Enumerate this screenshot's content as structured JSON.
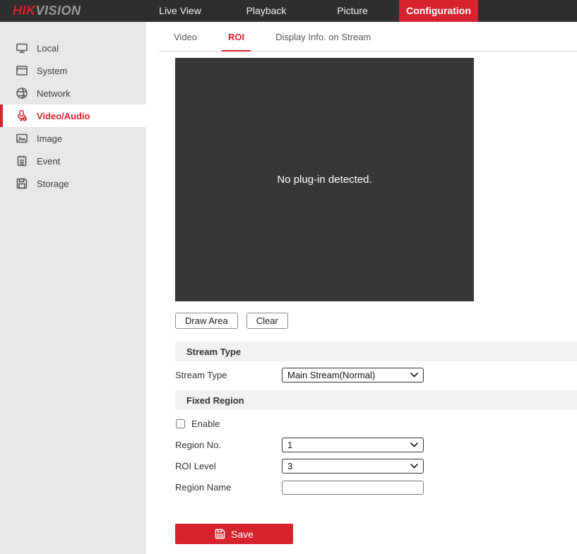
{
  "topbar": {
    "logo": {
      "hik": "HIK",
      "vision": "VISION"
    },
    "items": [
      {
        "label": "Live View",
        "active": false
      },
      {
        "label": "Playback",
        "active": false
      },
      {
        "label": "Picture",
        "active": false
      },
      {
        "label": "Configuration",
        "active": true
      }
    ]
  },
  "sidebar": {
    "items": [
      {
        "label": "Local",
        "icon": "monitor-icon",
        "active": false
      },
      {
        "label": "System",
        "icon": "window-icon",
        "active": false
      },
      {
        "label": "Network",
        "icon": "globe-icon",
        "active": false
      },
      {
        "label": "Video/Audio",
        "icon": "mic-av-icon",
        "active": true
      },
      {
        "label": "Image",
        "icon": "image-icon",
        "active": false
      },
      {
        "label": "Event",
        "icon": "event-notepad-icon",
        "active": false
      },
      {
        "label": "Storage",
        "icon": "storage-floppy-icon",
        "active": false
      }
    ]
  },
  "tabs": {
    "items": [
      {
        "label": "Video",
        "active": false
      },
      {
        "label": "ROI",
        "active": true
      },
      {
        "label": "Display Info. on Stream",
        "active": false
      }
    ]
  },
  "player": {
    "message": "No plug-in detected."
  },
  "toolbar": {
    "draw_area_label": "Draw Area",
    "clear_label": "Clear"
  },
  "stream_type": {
    "header": "Stream Type",
    "label": "Stream Type",
    "value": "Main Stream(Normal)"
  },
  "fixed_region": {
    "header": "Fixed Region",
    "enable_label": "Enable",
    "enabled": false,
    "region_no_label": "Region No.",
    "region_no_value": "1",
    "roi_level_label": "ROI Level",
    "roi_level_value": "3",
    "region_name_label": "Region Name",
    "region_name_value": ""
  },
  "save": {
    "label": "Save",
    "icon": "save-floppy-icon"
  },
  "colors": {
    "accent": "#d7232e",
    "topbar_bg": "#2e2e2e",
    "sidebar_bg": "#e8e8e8",
    "section_bar_bg": "#f1f1f1",
    "player_bg": "#37373a"
  }
}
